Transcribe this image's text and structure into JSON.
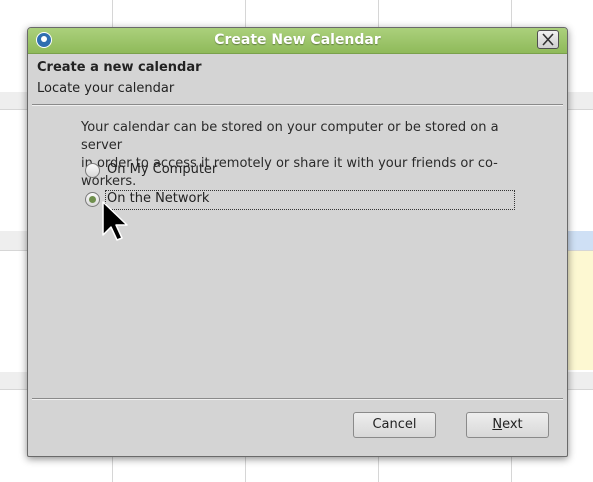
{
  "dialog": {
    "title": "Create New Calendar",
    "header_title": "Create a new calendar",
    "header_subtitle": "Locate your calendar",
    "description_line1": "Your calendar can be stored on your computer or be stored on a server",
    "description_line2": "in order to access it remotely or share it with your friends or co-workers.",
    "options": [
      {
        "label": "On My Computer",
        "checked": false
      },
      {
        "label": "On the Network",
        "checked": true
      }
    ],
    "buttons": {
      "cancel_label": "Cancel",
      "next_label_accesskey": "N",
      "next_label_rest": "ext"
    }
  },
  "icons": {
    "title_icon": "calendar-app-icon",
    "close_icon": "close-icon",
    "cursor": "mouse-pointer-icon"
  },
  "colors": {
    "titlebar": "#9bc46a",
    "dialog_bg": "#d4d4d4",
    "radio_dot": "#6f8f4d"
  }
}
